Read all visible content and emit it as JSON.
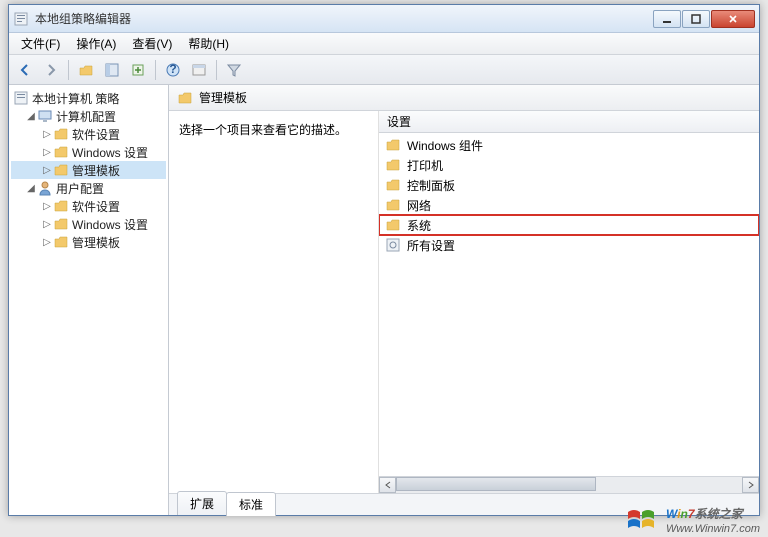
{
  "window": {
    "title": "本地组策略编辑器"
  },
  "menubar": [
    {
      "label": "文件(F)"
    },
    {
      "label": "操作(A)"
    },
    {
      "label": "查看(V)"
    },
    {
      "label": "帮助(H)"
    }
  ],
  "tree": {
    "root": {
      "label": "本地计算机 策略"
    },
    "computer": {
      "label": "计算机配置"
    },
    "computer_children": [
      {
        "label": "软件设置"
      },
      {
        "label": "Windows 设置"
      },
      {
        "label": "管理模板"
      }
    ],
    "user": {
      "label": "用户配置"
    },
    "user_children": [
      {
        "label": "软件设置"
      },
      {
        "label": "Windows 设置"
      },
      {
        "label": "管理模板"
      }
    ]
  },
  "header": {
    "title": "管理模板"
  },
  "description": {
    "prompt": "选择一个项目来查看它的描述。"
  },
  "list": {
    "header": "设置",
    "items": [
      {
        "label": "Windows 组件",
        "type": "folder"
      },
      {
        "label": "打印机",
        "type": "folder"
      },
      {
        "label": "控制面板",
        "type": "folder"
      },
      {
        "label": "网络",
        "type": "folder"
      },
      {
        "label": "系统",
        "type": "folder",
        "highlighted": true
      },
      {
        "label": "所有设置",
        "type": "settings"
      }
    ]
  },
  "tabs": [
    {
      "label": "扩展",
      "active": false
    },
    {
      "label": "标准",
      "active": true
    }
  ],
  "watermark": {
    "line1_parts": {
      "w": "W",
      "i": "i",
      "n": "n",
      "num": "7",
      "rest": "系统之家"
    },
    "line2": "Www.Winwin7.com"
  }
}
